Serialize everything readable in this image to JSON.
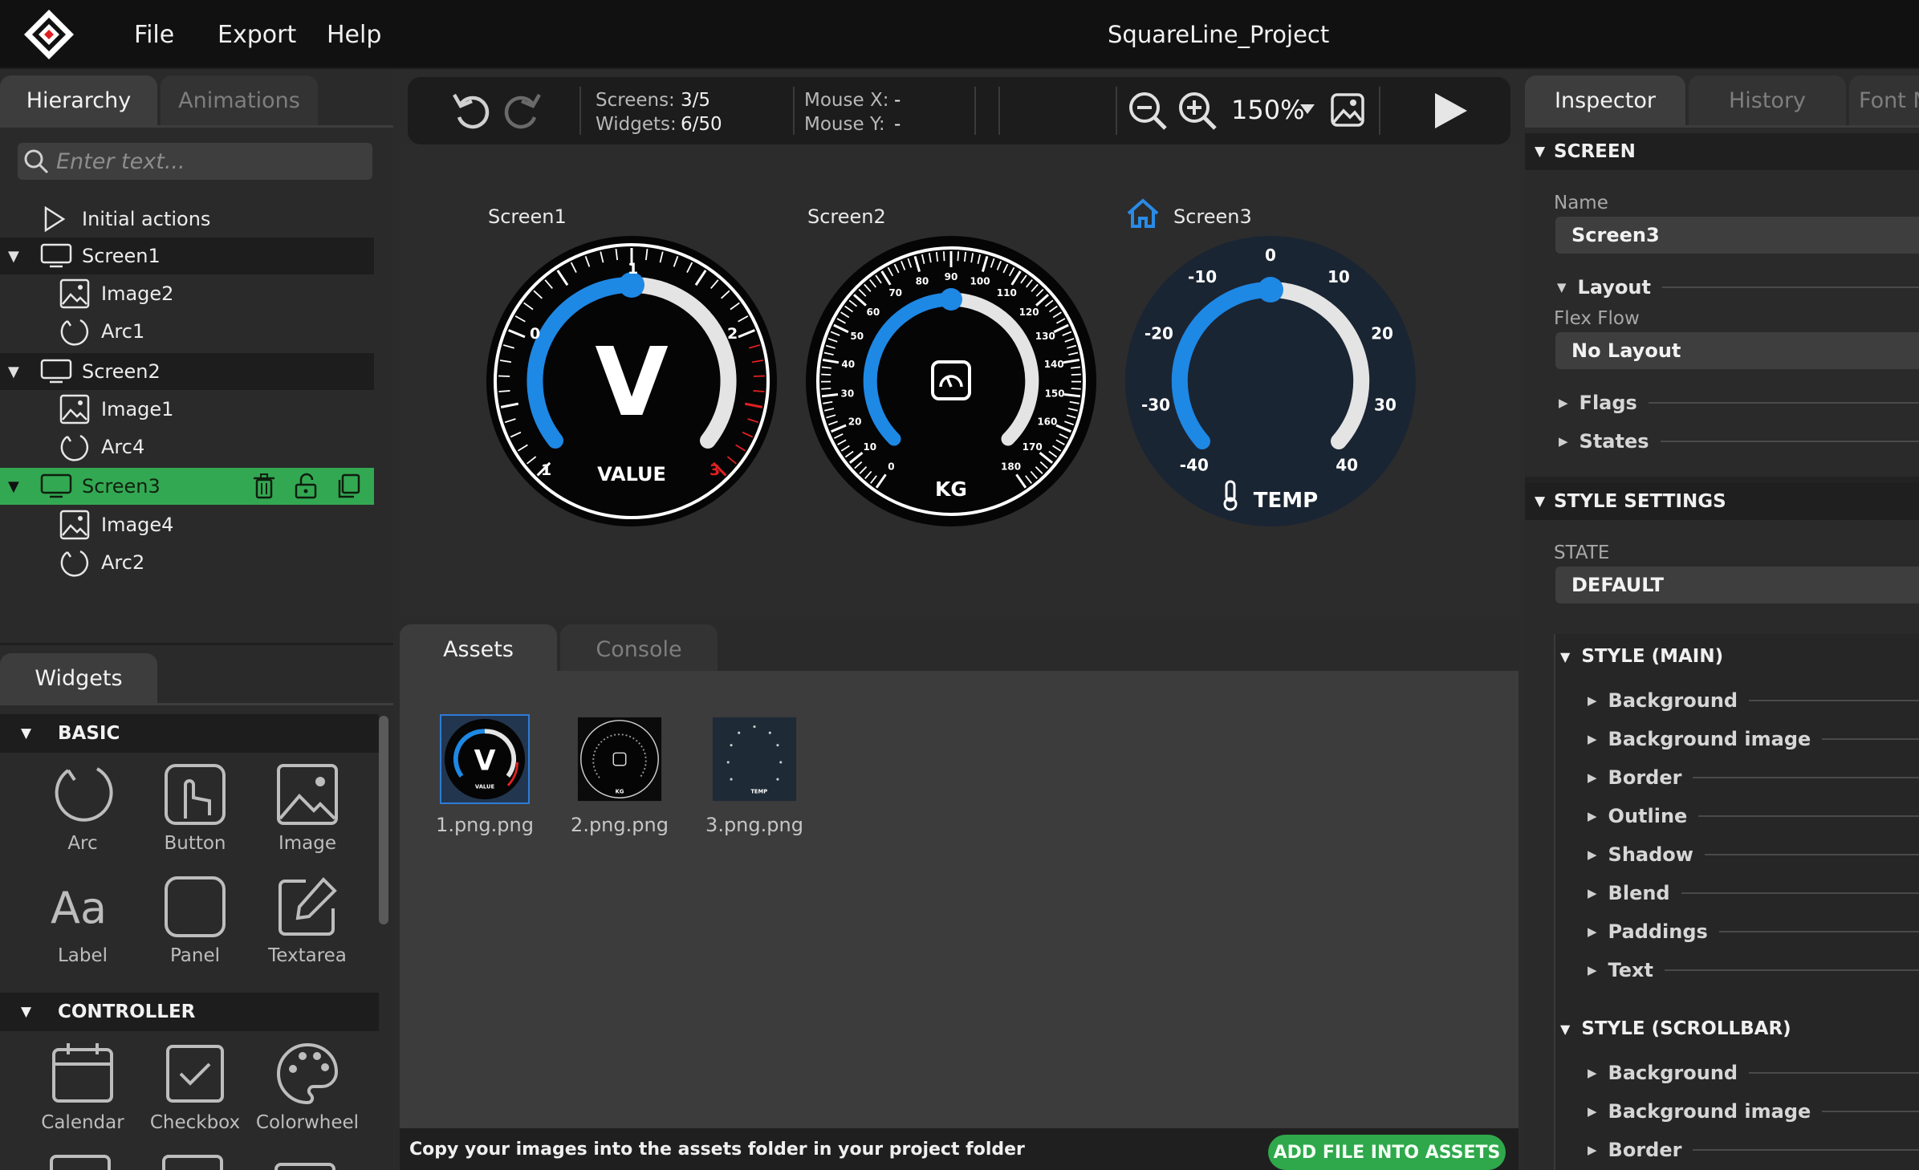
{
  "app": {
    "title": "SquareLine_Project",
    "menu": [
      "File",
      "Export",
      "Help"
    ]
  },
  "hierarchy": {
    "tabs": [
      "Hierarchy",
      "Animations"
    ],
    "search_placeholder": "Enter text...",
    "initial_actions": "Initial actions",
    "items": [
      {
        "label": "Screen1",
        "children": [
          "Image2",
          "Arc1"
        ]
      },
      {
        "label": "Screen2",
        "children": [
          "Image1",
          "Arc4"
        ]
      },
      {
        "label": "Screen3",
        "children": [
          "Image4",
          "Arc2"
        ]
      }
    ]
  },
  "widgets": {
    "tab": "Widgets",
    "basic": {
      "title": "BASIC",
      "items": [
        "Arc",
        "Button",
        "Image",
        "Label",
        "Panel",
        "Textarea"
      ]
    },
    "controller": {
      "title": "CONTROLLER",
      "items": [
        "Calendar",
        "Checkbox",
        "Colorwheel"
      ]
    }
  },
  "toolbar": {
    "screens_label": "Screens:",
    "screens_value": "3/5",
    "widgets_label": "Widgets:",
    "widgets_value": "6/50",
    "mouse_x_label": "Mouse X:",
    "mouse_x_value": "-",
    "mouse_y_label": "Mouse Y:",
    "mouse_y_value": "-",
    "zoom": "150%"
  },
  "canvas": {
    "screens": [
      {
        "label": "Screen1",
        "gauge_text": "VALUE",
        "center": "V",
        "ticks": [
          "0",
          "1",
          "2",
          "1",
          "3"
        ]
      },
      {
        "label": "Screen2",
        "gauge_text": "KG",
        "ticks": [
          "0",
          "10",
          "20",
          "30",
          "40",
          "50",
          "60",
          "70",
          "80",
          "90",
          "100",
          "110",
          "120",
          "130",
          "140",
          "150",
          "160",
          "170",
          "180"
        ]
      },
      {
        "label": "Screen3",
        "gauge_text": "TEMP",
        "ticks": [
          "-40",
          "-30",
          "-20",
          "-10",
          "0",
          "10",
          "20",
          "30",
          "40"
        ]
      }
    ]
  },
  "bottom": {
    "tabs": [
      "Assets",
      "Console"
    ],
    "assets": [
      "1.png.png",
      "2.png.png",
      "3.png.png"
    ],
    "status": "Copy your images into the assets folder in your project folder",
    "add_button": "ADD FILE INTO ASSETS"
  },
  "inspector": {
    "tabs": [
      "Inspector",
      "History",
      "Font M"
    ],
    "screen_section": "SCREEN",
    "name_label": "Name",
    "name_value": "Screen3",
    "layout_label": "Layout",
    "flex_flow_label": "Flex Flow",
    "flex_flow_value": "No Layout",
    "flags_label": "Flags",
    "states_label": "States",
    "style_settings": "STYLE SETTINGS",
    "state_label": "STATE",
    "state_value": "DEFAULT",
    "style_main": "STYLE (MAIN)",
    "main_props": [
      "Background",
      "Background image",
      "Border",
      "Outline",
      "Shadow",
      "Blend",
      "Paddings",
      "Text"
    ],
    "style_scrollbar": "STYLE (SCROLLBAR)",
    "scrollbar_props": [
      "Background",
      "Background image",
      "Border"
    ]
  },
  "colors": {
    "accent_green": "#33a852",
    "arc_blue": "#1e88e5",
    "tick_red": "#e02020",
    "selection_blue": "#2e7bd6"
  }
}
